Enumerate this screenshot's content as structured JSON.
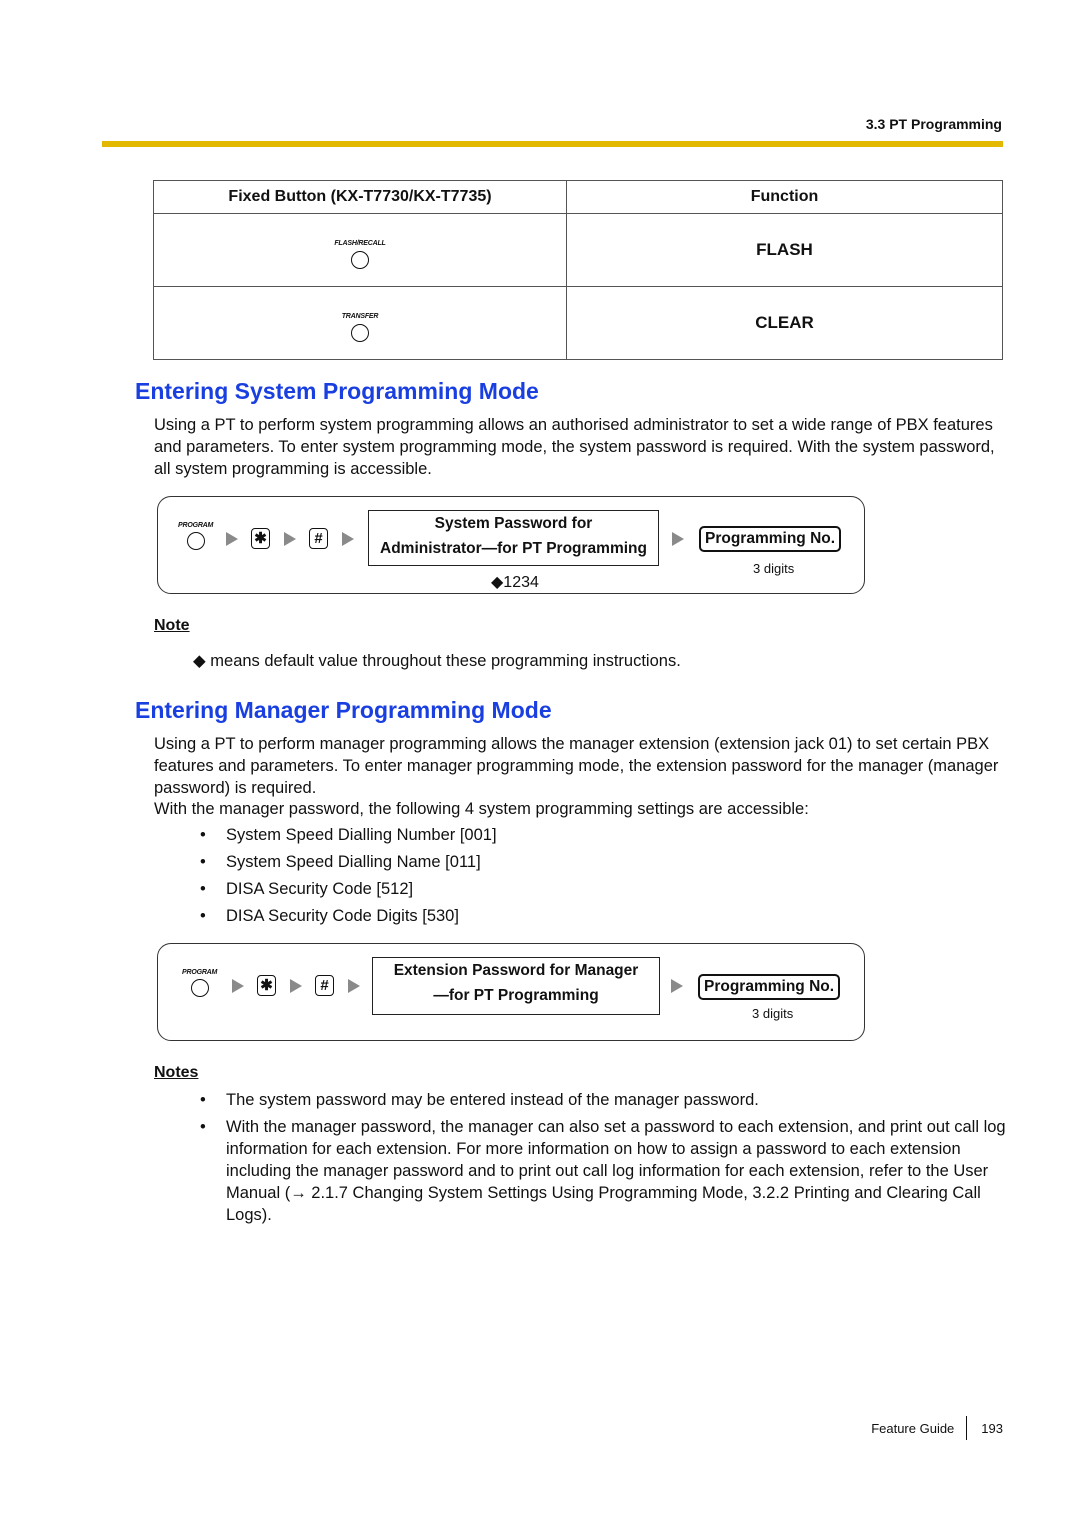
{
  "header": {
    "section": "3.3 PT Programming",
    "rule_color": "#e3b800"
  },
  "table": {
    "headers": [
      "Fixed Button (KX-T7730/KX-T7735)",
      "Function"
    ],
    "rows": [
      {
        "button_label": "FLASH/RECALL",
        "function": "FLASH"
      },
      {
        "button_label": "TRANSFER",
        "function": "CLEAR"
      }
    ]
  },
  "system_mode": {
    "heading": "Entering System Programming Mode",
    "paragraph": "Using a PT to perform system programming allows an authorised administrator to set a wide range of PBX features and parameters. To enter system programming mode, the system password is required. With the system password, all system programming is accessible.",
    "flow": {
      "program_label": "PROGRAM",
      "star_key": "✱",
      "hash_key": "#",
      "password_line1": "System Password for",
      "password_line2": "Administrator—for PT Programming",
      "default_value": "◆1234",
      "prog_no": "Programming No.",
      "digits": "3 digits"
    },
    "note_title": "Note",
    "note_text": "◆ means default value throughout these programming instructions."
  },
  "manager_mode": {
    "heading": "Entering Manager Programming Mode",
    "paragraph1": "Using a PT to perform manager programming allows the manager extension (extension jack 01) to set certain PBX features and parameters. To enter manager programming mode, the extension password for the manager (manager password) is required.",
    "paragraph2": "With the manager password, the following 4 system programming settings are accessible:",
    "settings": [
      "System Speed Dialling Number [001]",
      "System Speed Dialling Name [011]",
      "DISA Security Code [512]",
      "DISA Security Code Digits [530]"
    ],
    "flow": {
      "program_label": "PROGRAM",
      "star_key": "✱",
      "hash_key": "#",
      "password_line1": "Extension Password for Manager",
      "password_line2": "—for PT Programming",
      "prog_no": "Programming No.",
      "digits": "3 digits"
    },
    "notes_title": "Notes",
    "notes": [
      "The system password may be entered instead of the manager password.",
      "With the manager password, the manager can also set a password to each extension, and print out call log information for each extension. For more information on how to assign a password to each extension including the manager password and to print out call log information for each extension, refer to the User Manual (→ 2.1.7 Changing System Settings Using Programming Mode, 3.2.2 Printing and Clearing Call Logs)."
    ]
  },
  "footer": {
    "title": "Feature Guide",
    "page": "193"
  }
}
